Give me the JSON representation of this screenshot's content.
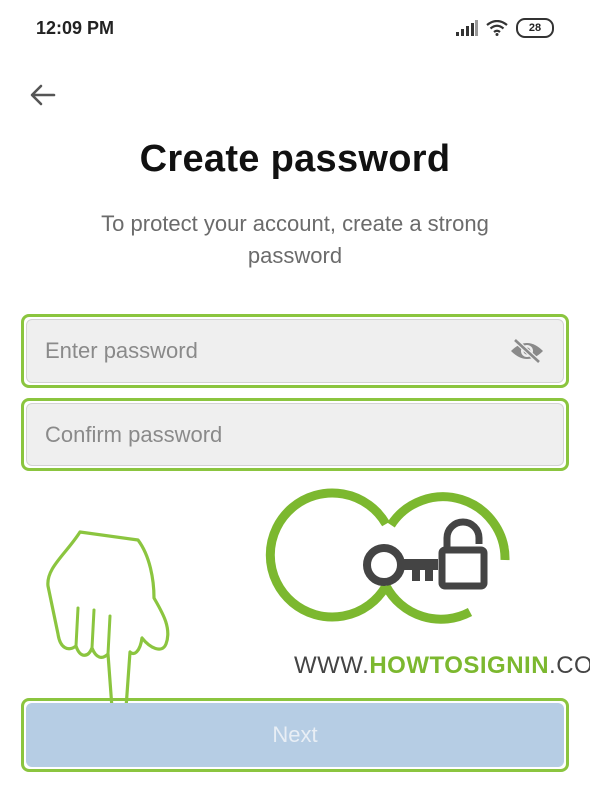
{
  "status_bar": {
    "time": "12:09 PM",
    "battery": "28"
  },
  "header": {
    "back_icon": "arrow-left-icon",
    "title": "Create password",
    "subtitle": "To protect your account, create a strong password"
  },
  "form": {
    "password": {
      "placeholder": "Enter password",
      "value": "",
      "visibility_icon": "eye-off-icon"
    },
    "confirm": {
      "placeholder": "Confirm password",
      "value": ""
    }
  },
  "watermark": {
    "prefix": "WWW.",
    "brand": "HOWTOSIGNIN",
    "suffix": ".COM"
  },
  "actions": {
    "next_label": "Next"
  },
  "colors": {
    "highlight": "#8bc53f",
    "button_disabled": "#b6cde4",
    "brand_green": "#7cb82f"
  }
}
